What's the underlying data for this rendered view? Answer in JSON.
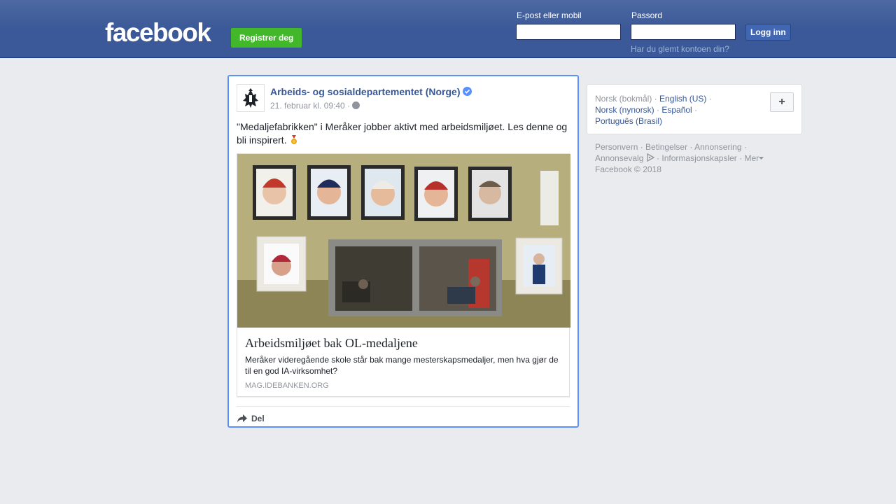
{
  "header": {
    "logo": "facebook",
    "register_label": "Registrer deg",
    "email_label": "E-post eller mobil",
    "password_label": "Passord",
    "login_label": "Logg inn",
    "forgot_label": "Har du glemt kontoen din?",
    "email_value": "",
    "password_value": ""
  },
  "post": {
    "page_name": "Arbeids- og sosialdepartementet (Norge)",
    "timestamp": "21. februar kl. 09:40 ·",
    "text": "\"Medaljefabrikken\" i Meråker jobber aktivt med arbeidsmiljøet. Les denne og bli inspirert.",
    "link": {
      "title": "Arbeidsmiljøet bak OL-medaljene",
      "description": "Meråker videregående skole står bak mange mesterskapsmedaljer, men hva gjør de til en god IA-virksomhet?",
      "domain": "MAG.IDEBANKEN.ORG"
    },
    "share_label": "Del"
  },
  "languages": {
    "current": "Norsk (bokmål)",
    "options": [
      "English (US)",
      "Norsk (nynorsk)",
      "Español",
      "Português (Brasil)"
    ],
    "more_label": "+"
  },
  "footer": {
    "links": [
      "Personvern",
      "Betingelser",
      "Annonsering",
      "Annonsevalg",
      "Informasjonskapsler",
      "Mer"
    ],
    "copyright": "Facebook © 2018"
  },
  "colors": {
    "brand": "#3b5998",
    "register_green": "#42b72a",
    "link_blue": "#365899",
    "focus_border": "#5890ff"
  },
  "icons": [
    "coat-of-arms-icon",
    "verified-badge-icon",
    "globe-icon",
    "medal-icon",
    "share-arrow-icon",
    "adchoices-icon",
    "chevron-down-icon"
  ]
}
